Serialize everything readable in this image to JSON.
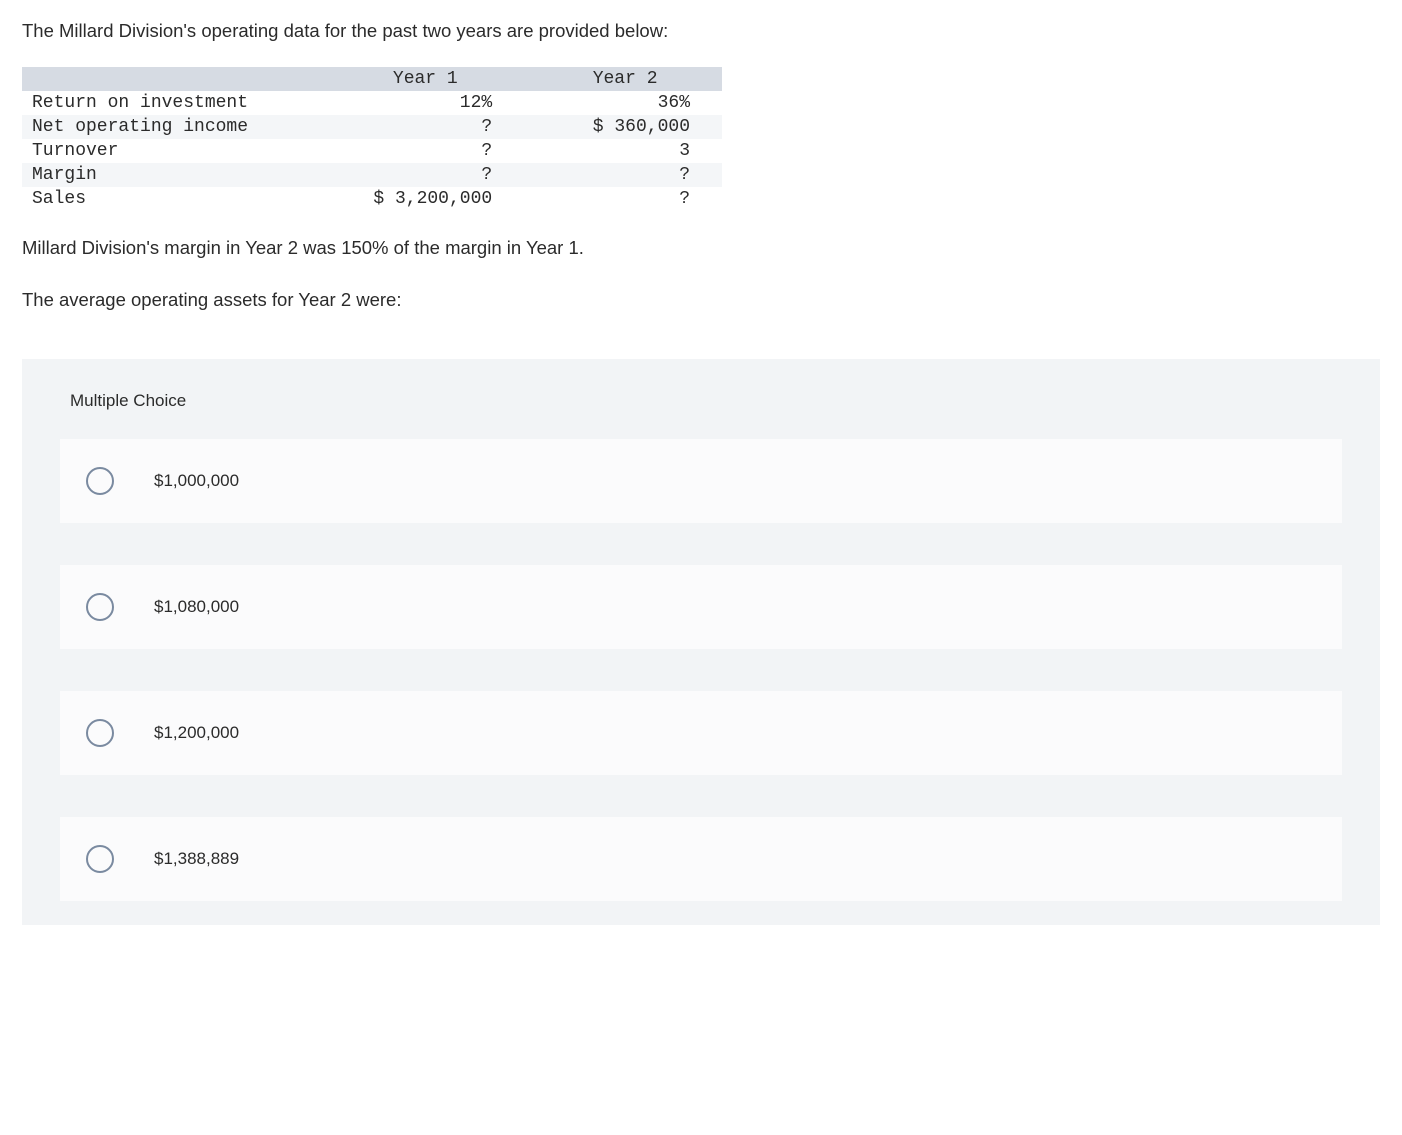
{
  "question": {
    "intro": "The Millard Division's operating data for the past two years are provided below:",
    "followup": "Millard Division's margin in Year 2 was 150% of the margin in Year 1.",
    "prompt": "The average operating assets for Year 2 were:"
  },
  "table": {
    "headers": {
      "blank": "",
      "year1": "Year 1",
      "year2": "Year 2"
    },
    "rows": [
      {
        "label": "Return on investment",
        "year1": "12%",
        "year2": "36%"
      },
      {
        "label": "Net operating income",
        "year1": "?",
        "year2": "$ 360,000"
      },
      {
        "label": "Turnover",
        "year1": "?",
        "year2": "3"
      },
      {
        "label": "Margin",
        "year1": "?",
        "year2": "?"
      },
      {
        "label": "Sales",
        "year1": "$ 3,200,000",
        "year2": "?"
      }
    ]
  },
  "mc": {
    "heading": "Multiple Choice",
    "options": [
      {
        "label": "$1,000,000"
      },
      {
        "label": "$1,080,000"
      },
      {
        "label": "$1,200,000"
      },
      {
        "label": "$1,388,889"
      }
    ]
  }
}
